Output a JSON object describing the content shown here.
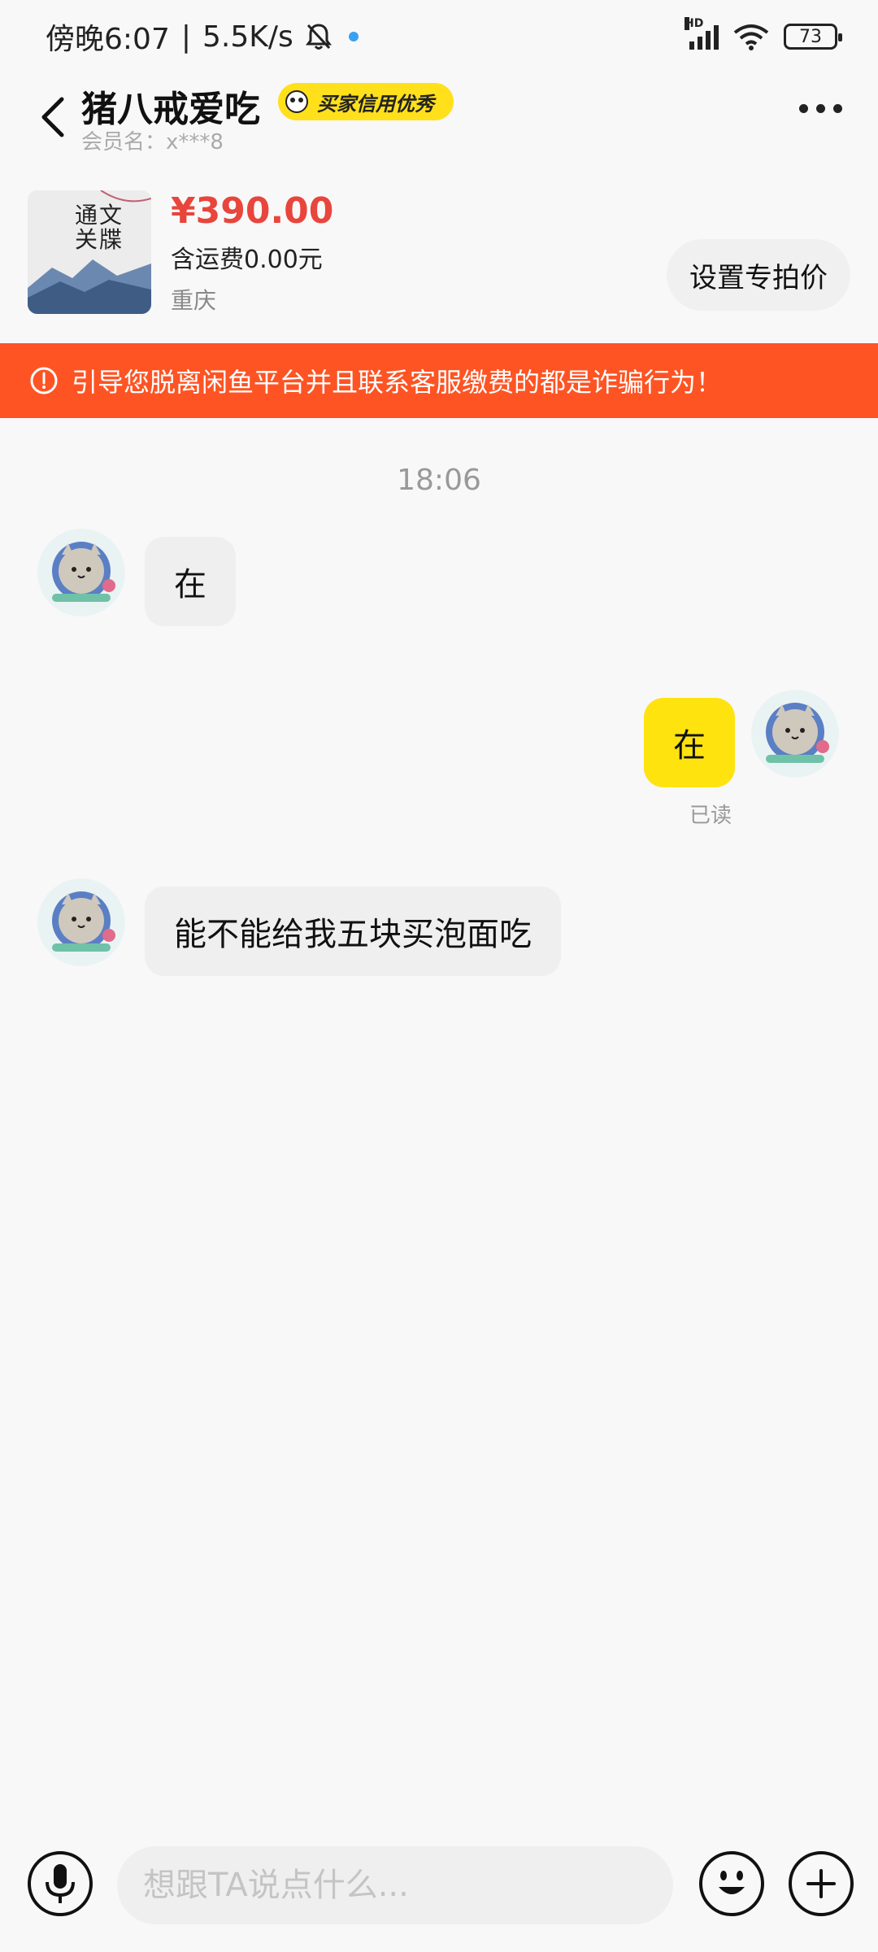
{
  "status_bar": {
    "time": "傍晚6:07",
    "speed": "5.5K/s",
    "battery": "73",
    "network": "HD"
  },
  "header": {
    "title": "猪八戒爱吃",
    "badge": "买家信用优秀",
    "member_name": "会员名：x***8"
  },
  "product": {
    "price": "¥390.00",
    "shipping": "含运费0.00元",
    "location": "重庆",
    "special_price_button": "设置专拍价",
    "image_text": "通关文牒"
  },
  "warning": {
    "text": "引导您脱离闲鱼平台并且联系客服缴费的都是诈骗行为！"
  },
  "chat": {
    "timestamp": "18:06",
    "messages": [
      {
        "text": "在",
        "from": "other"
      },
      {
        "text": "在",
        "from": "me",
        "status": "已读"
      },
      {
        "text": "能不能给我五块买泡面吃",
        "from": "other"
      }
    ]
  },
  "input_bar": {
    "placeholder": "想跟TA说点什么..."
  },
  "colors": {
    "accent_yellow": "#ffe30f",
    "warning_orange": "#fe5424",
    "price_red": "#e8453c"
  }
}
